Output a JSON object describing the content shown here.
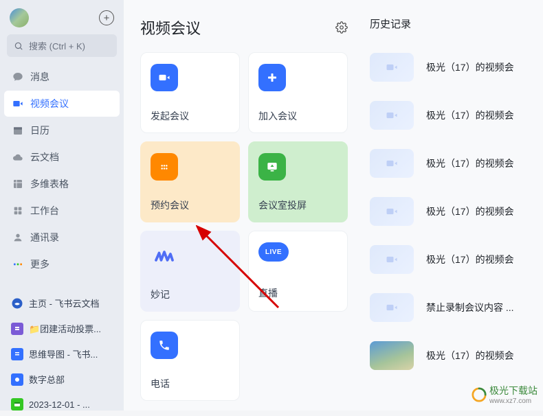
{
  "sidebar": {
    "search_placeholder": "搜索 (Ctrl + K)",
    "nav": [
      {
        "label": "消息",
        "icon": "chat"
      },
      {
        "label": "视频会议",
        "icon": "video",
        "active": true
      },
      {
        "label": "日历",
        "icon": "calendar"
      },
      {
        "label": "云文档",
        "icon": "cloud-doc"
      },
      {
        "label": "多维表格",
        "icon": "base"
      },
      {
        "label": "工作台",
        "icon": "apps"
      },
      {
        "label": "通讯录",
        "icon": "contacts"
      },
      {
        "label": "更多",
        "icon": "more"
      }
    ],
    "docs": [
      {
        "label": "主页 - 飞书云文档",
        "icon": "home",
        "color": "#3370ff"
      },
      {
        "label": "📁团建活动投票...",
        "icon": "doc-purple",
        "color": "#7b5bd6"
      },
      {
        "label": "思维导图 - 飞书...",
        "icon": "doc-blue",
        "color": "#3370ff"
      },
      {
        "label": "数字总部",
        "icon": "doc-blue2",
        "color": "#3370ff"
      },
      {
        "label": "2023-12-01 - ...",
        "icon": "doc-green",
        "color": "#34c724"
      }
    ]
  },
  "meeting": {
    "title": "视频会议",
    "cards": {
      "start": "发起会议",
      "join": "加入会议",
      "schedule": "预约会议",
      "cast": "会议室投屏",
      "note": "妙记",
      "live": "直播",
      "live_badge": "LIVE",
      "phone": "电话"
    }
  },
  "history": {
    "title": "历史记录",
    "items": [
      {
        "label": "极光（17）的视频会"
      },
      {
        "label": "极光（17）的视频会"
      },
      {
        "label": "极光（17）的视频会"
      },
      {
        "label": "极光（17）的视频会"
      },
      {
        "label": "极光（17）的视频会"
      },
      {
        "label": "禁止录制会议内容 ..."
      },
      {
        "label": "极光（17）的视频会",
        "thumb": "img"
      }
    ]
  },
  "watermark": {
    "name": "极光下载站",
    "url": "www.xz7.com"
  }
}
